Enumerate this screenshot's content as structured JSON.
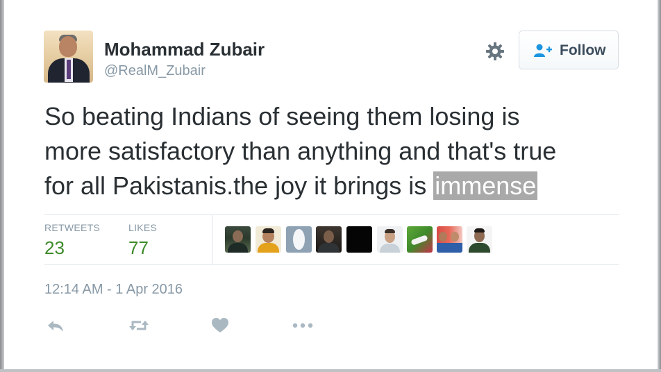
{
  "author": {
    "name": "Mohammad Zubair",
    "handle": "@RealM_Zubair",
    "avatar_icon": "profile-photo"
  },
  "header_actions": {
    "settings_icon": "gear-icon",
    "follow_label": "Follow",
    "follow_icon": "add-user-icon"
  },
  "tweet": {
    "lines": [
      "So beating Indians of seeing them losing is",
      "more satisfactory than anything and that's true",
      "for all Pakistanis.the joy it brings is "
    ],
    "highlighted": "immense",
    "highlight_color": "#a9a9a9"
  },
  "stats": {
    "retweets_label": "RETWEETS",
    "retweets_value": "23",
    "likes_label": "LIKES",
    "likes_value": "77",
    "value_color": "#3e8a2a"
  },
  "likers": [
    {
      "name": "liker-1"
    },
    {
      "name": "liker-2"
    },
    {
      "name": "liker-3"
    },
    {
      "name": "liker-4"
    },
    {
      "name": "liker-5"
    },
    {
      "name": "liker-6"
    },
    {
      "name": "liker-7"
    },
    {
      "name": "liker-8"
    },
    {
      "name": "liker-9"
    }
  ],
  "timestamp": "12:14 AM - 1 Apr 2016",
  "actions": [
    {
      "name": "reply-icon"
    },
    {
      "name": "retweet-icon"
    },
    {
      "name": "like-heart-icon"
    },
    {
      "name": "more-options-icon"
    }
  ],
  "colors": {
    "text": "#292f33",
    "muted": "#8899a6",
    "divider": "#e1e8ed",
    "action_icon": "#aab8c2"
  }
}
